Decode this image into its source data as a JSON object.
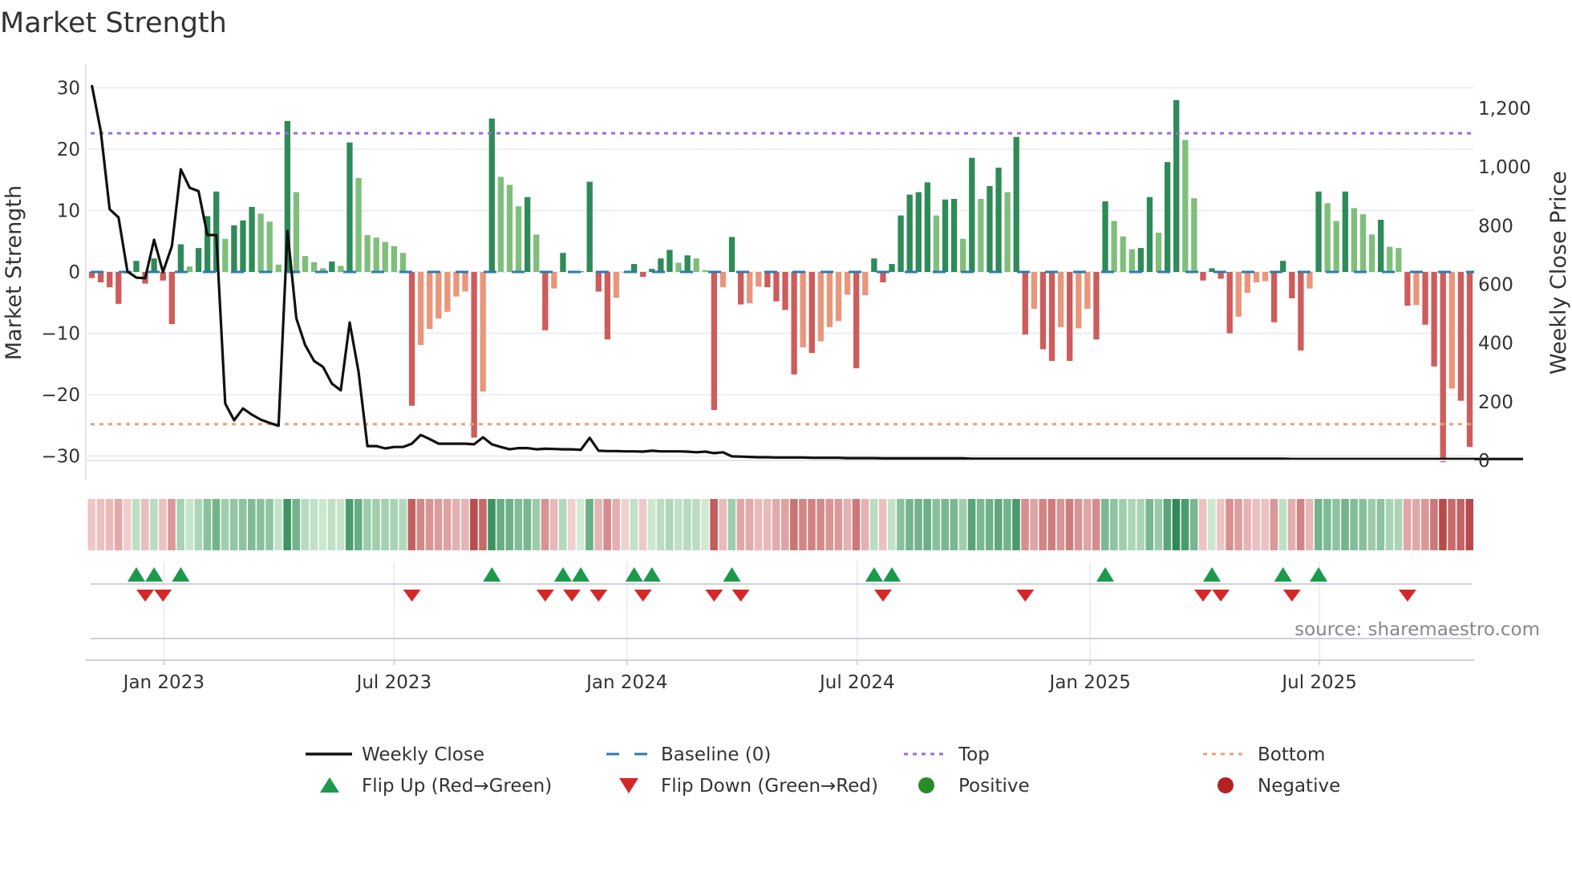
{
  "chart_data": {
    "type": "bar",
    "title": "Market Strength",
    "ylabel": "Market Strength",
    "y2label": "Weekly Close Price",
    "ylim": [
      -32,
      32
    ],
    "y2lim": [
      0,
      1300
    ],
    "yticks": [
      30,
      20,
      10,
      0,
      -10,
      -20,
      -30
    ],
    "ytick_labels": [
      "30",
      "20",
      "10",
      "0",
      "−10",
      "−20",
      "−30"
    ],
    "y2ticks": [
      0,
      200,
      400,
      600,
      800,
      1000,
      1200
    ],
    "y2tick_labels": [
      "0",
      "200",
      "400",
      "600",
      "800",
      "1,000",
      "1,200"
    ],
    "xtick_labels": [
      "Jan 2023",
      "Jul 2023",
      "Jan 2024",
      "Jul 2024",
      "Jan 2025",
      "Jul 2025"
    ],
    "grid": true,
    "top_level": 22.6,
    "bottom_level": -24.8,
    "baseline": 0,
    "strength": [
      -1,
      -1.7,
      -2.5,
      -5.2,
      -0.3,
      1.8,
      -1.9,
      2.2,
      -1.4,
      -8.5,
      4.5,
      0.9,
      3.9,
      9.1,
      13.1,
      5.4,
      7.6,
      8.4,
      10.6,
      9.5,
      8.2,
      1.2,
      24.6,
      13,
      2.6,
      1.6,
      0.6,
      1.7,
      1.0,
      21.1,
      15.3,
      6,
      5.6,
      4.9,
      4.2,
      3.1,
      -21.8,
      -11.9,
      -9.3,
      -7.6,
      -6.5,
      -4,
      -3.2,
      -27,
      -19.5,
      25,
      15.5,
      14.2,
      10.7,
      12.2,
      6.1,
      -9.5,
      -2.7,
      3.1,
      -0.1,
      0.1,
      14.7,
      -3.2,
      -11,
      -4.2,
      -0.1,
      1.3,
      -0.8,
      0.5,
      2.2,
      3.6,
      1.5,
      2.7,
      2.2,
      0.3,
      -22.5,
      -2.5,
      5.7,
      -5.3,
      -5.1,
      -2.4,
      -2.5,
      -4.8,
      -6.2,
      -16.7,
      -12.3,
      -13.2,
      -11.3,
      -9,
      -8,
      -3.7,
      -15.7,
      -3.8,
      2.2,
      -1.7,
      1.3,
      9.2,
      12.6,
      13,
      14.6,
      9.2,
      11.8,
      11.9,
      5.4,
      18.6,
      11.9,
      14,
      17,
      13,
      22,
      -10.2,
      -6,
      -12.6,
      -14.5,
      -9,
      -14.5,
      -9.2,
      -6,
      -11,
      11.5,
      8.3,
      5.8,
      3.7,
      3.9,
      12.2,
      6.4,
      17.9,
      28,
      21.5,
      12,
      -1.4,
      0.6,
      -1.1,
      -10,
      -7.3,
      -3.4,
      -1.7,
      -1.5,
      -8.2,
      1.8,
      -4.3,
      -12.8,
      -2.7,
      13.1,
      11.2,
      8.3,
      13.1,
      10.4,
      9.4,
      6.1,
      8.5,
      4.1,
      3.9,
      -5.5,
      -5.4,
      -8.6,
      -15.4,
      -31,
      -19,
      -21,
      -28.5
    ],
    "weekly_close": [
      1279,
      1123,
      856,
      828,
      644,
      623,
      621,
      752,
      642,
      730,
      992,
      929,
      918,
      768,
      768,
      194,
      137,
      177,
      156,
      139,
      128,
      118,
      782,
      484,
      393,
      339,
      319,
      262,
      239,
      470,
      303,
      49,
      49,
      41,
      46,
      46,
      57,
      87,
      73,
      57,
      57,
      57,
      57,
      55,
      79,
      55,
      46,
      38,
      42,
      42,
      38,
      40,
      39,
      38,
      38,
      36,
      77,
      33,
      32,
      32,
      31,
      31,
      30,
      33,
      31,
      31,
      31,
      30,
      28,
      30,
      25,
      28,
      14,
      13,
      12,
      11,
      11,
      10,
      10,
      10,
      10,
      9,
      9,
      9,
      9,
      8,
      8,
      8,
      8,
      7,
      7,
      7,
      7,
      7,
      7,
      7,
      7,
      7,
      7,
      6,
      6,
      6,
      6,
      6,
      6,
      6,
      6,
      6,
      6,
      6,
      6,
      6,
      6,
      6,
      6,
      6,
      6,
      6,
      6,
      6,
      6,
      6,
      6,
      6,
      6,
      6,
      6,
      6,
      6,
      6,
      6,
      6,
      6,
      6,
      6,
      5,
      5,
      5,
      5,
      5,
      5,
      5,
      5,
      5,
      5,
      5,
      5,
      5,
      5,
      5,
      5,
      5,
      5,
      5,
      5,
      5,
      5,
      5,
      5,
      5,
      5,
      5
    ],
    "legend": {
      "placement": "bottom",
      "items": [
        {
          "label": "Weekly Close",
          "kind": "line",
          "color": "#111111"
        },
        {
          "label": "Baseline (0)",
          "kind": "dash",
          "color": "#2e7bb0"
        },
        {
          "label": "Top",
          "kind": "dot",
          "color": "#9b6bdc"
        },
        {
          "label": "Bottom",
          "kind": "dot",
          "color": "#f0a070"
        },
        {
          "label": "Flip Up (Red→Green)",
          "kind": "tri-up",
          "color": "#1a9a4a"
        },
        {
          "label": "Flip Down (Green→Red)",
          "kind": "tri-down",
          "color": "#d62728"
        },
        {
          "label": "Positive",
          "kind": "circle",
          "color": "#2a8a2a"
        },
        {
          "label": "Negative",
          "kind": "circle",
          "color": "#b22222"
        }
      ]
    },
    "colors": {
      "pos_strong": "#2e8b57",
      "pos_weak": "#7fbf7b",
      "neg_strong": "#cd5c5c",
      "neg_weak": "#e9967a",
      "price_line": "#111111",
      "top": "#9b6bdc",
      "bottom": "#f0a070",
      "baseline": "#2e7bb0",
      "flip_up": "#1a9a4a",
      "flip_down": "#d62728"
    }
  },
  "source_note": "source: sharemaestro.com"
}
